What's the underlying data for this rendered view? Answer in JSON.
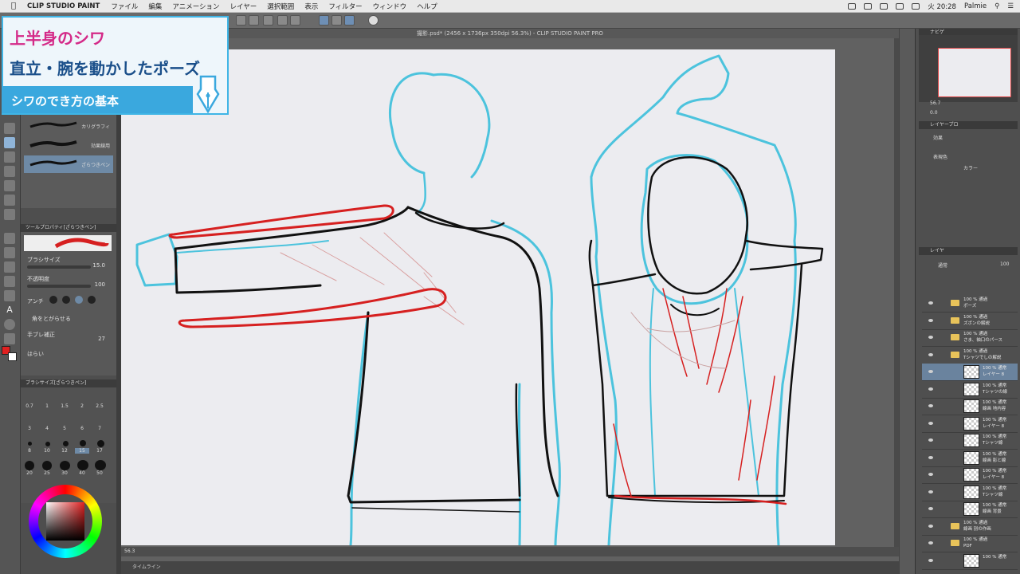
{
  "menubar": {
    "app_name": "CLIP STUDIO PAINT",
    "items": [
      "ファイル",
      "編集",
      "アニメーション",
      "レイヤー",
      "選択範囲",
      "表示",
      "フィルター",
      "ウィンドウ",
      "ヘルプ"
    ],
    "clock": "火 20:28",
    "user": "Palmie"
  },
  "document": {
    "title": "撮影.psd* (2456 x 1736px 350dpi 56.3%) - CLIP STUDIO PAINT PRO",
    "zoom": "56.3",
    "timeline_label": "タイムライン"
  },
  "overlay": {
    "line1": "上半身のシワ",
    "line2": "直立・腕を動かしたポーズ",
    "line3": "シワのでき方の基本"
  },
  "subtool": {
    "items": [
      "カリグラフィ",
      "効果線用",
      "ざらつきペン"
    ]
  },
  "tool_property": {
    "header": "ツールプロパティ[ざらつきペン]",
    "brush_name": "ざらつきペン",
    "brush_size_label": "ブラシサイズ",
    "brush_size_value": "15.0",
    "opacity_label": "不透明度",
    "opacity_value": "100",
    "antialias_label": "アンチ",
    "sharpen_label": "角をとがらせる",
    "stabilize_label": "手ブレ補正",
    "stabilize_value": "27",
    "taper_label": "はらい"
  },
  "brush_size_panel": {
    "header": "ブラシサイズ[ざらつきペン]",
    "sizes": [
      "0.7",
      "1",
      "1.5",
      "2",
      "2.5",
      "3",
      "4",
      "5",
      "6",
      "7",
      "8",
      "10",
      "12",
      "15",
      "17",
      "20",
      "25",
      "30",
      "40",
      "50"
    ]
  },
  "right_panel": {
    "navigator_tab": "ナビゲ",
    "zoom": "56.7",
    "angle": "0.0",
    "layer_prop_tab": "レイヤープロ",
    "effect_label": "効果",
    "color_label": "表現色",
    "color_value": "カラー",
    "layer_tab": "レイヤ",
    "blend_mode": "通常",
    "opacity": "100"
  },
  "layers": [
    {
      "text": "100 % 通過\nポーズ",
      "type": "folder"
    },
    {
      "text": "100 % 通過\nズボンの解説",
      "type": "folder"
    },
    {
      "text": "100 % 通過\nさま、袖口のパース",
      "type": "folder"
    },
    {
      "text": "100 % 通過\nTシャツでしの解説",
      "type": "folder"
    },
    {
      "text": "100 % 通常\nレイヤー 8",
      "type": "layer",
      "selected": true
    },
    {
      "text": "100 % 通常\nTシャツの線",
      "type": "layer"
    },
    {
      "text": "100 % 通常\n線画 地内容",
      "type": "layer"
    },
    {
      "text": "100 % 通常\nレイヤー 8",
      "type": "layer"
    },
    {
      "text": "100 % 通常\nTシャツ線",
      "type": "layer"
    },
    {
      "text": "100 % 通常\n線画 影と線",
      "type": "layer"
    },
    {
      "text": "100 % 通常\nレイヤー 8",
      "type": "layer"
    },
    {
      "text": "100 % 通常\nTシャツ線",
      "type": "layer"
    },
    {
      "text": "100 % 通常\n線画 背景",
      "type": "layer"
    },
    {
      "text": "100 % 通過\n線画 別の作画",
      "type": "folder"
    },
    {
      "text": "100 % 通過\nPDF",
      "type": "folder"
    },
    {
      "text": "100 % 通常",
      "type": "layer"
    }
  ],
  "colors": {
    "cyan_line": "#4cc3dd",
    "red_line": "#d62020",
    "black_line": "#111111",
    "overlay_pink": "#d42a88",
    "overlay_navy": "#1a4f8a",
    "overlay_blue": "#3aa8de"
  }
}
